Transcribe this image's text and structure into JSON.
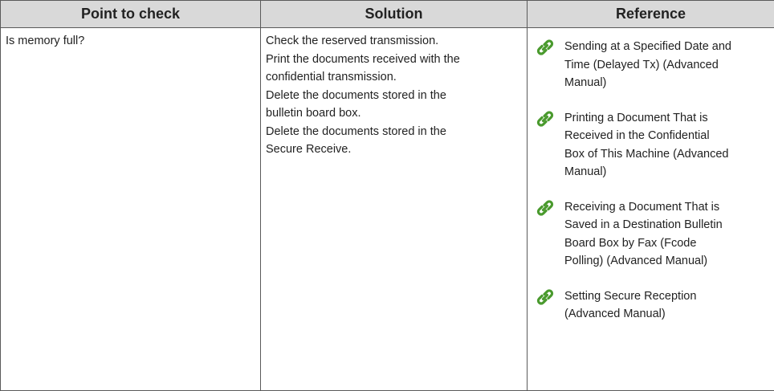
{
  "headers": [
    "Point to check",
    "Solution",
    "Reference"
  ],
  "row": {
    "point": "Is memory full?",
    "solution_lines": [
      "Check the reserved transmission.",
      "Print the documents received with the",
      "confidential transmission.",
      "Delete the documents stored in the",
      "bulletin board box.",
      "Delete the documents stored in the",
      "Secure Receive."
    ],
    "references": [
      {
        "icon": "link-icon",
        "lines": [
          "Sending at a Specified Date and",
          "Time (Delayed Tx) (Advanced",
          "Manual)"
        ]
      },
      {
        "icon": "link-icon",
        "lines": [
          "Printing a Document That is",
          "Received in the Confidential",
          "Box of This Machine (Advanced",
          "Manual)"
        ]
      },
      {
        "icon": "link-icon",
        "lines": [
          "Receiving a Document That is",
          "Saved in a Destination Bulletin",
          "Board Box by Fax (Fcode",
          "Polling) (Advanced Manual)"
        ]
      },
      {
        "icon": "link-icon",
        "lines": [
          "Setting Secure Reception",
          "(Advanced Manual)"
        ]
      }
    ]
  },
  "colors": {
    "header_bg": "#d9d9d9",
    "border": "#5a5a5a",
    "icon_green": "#4a9a2e"
  }
}
